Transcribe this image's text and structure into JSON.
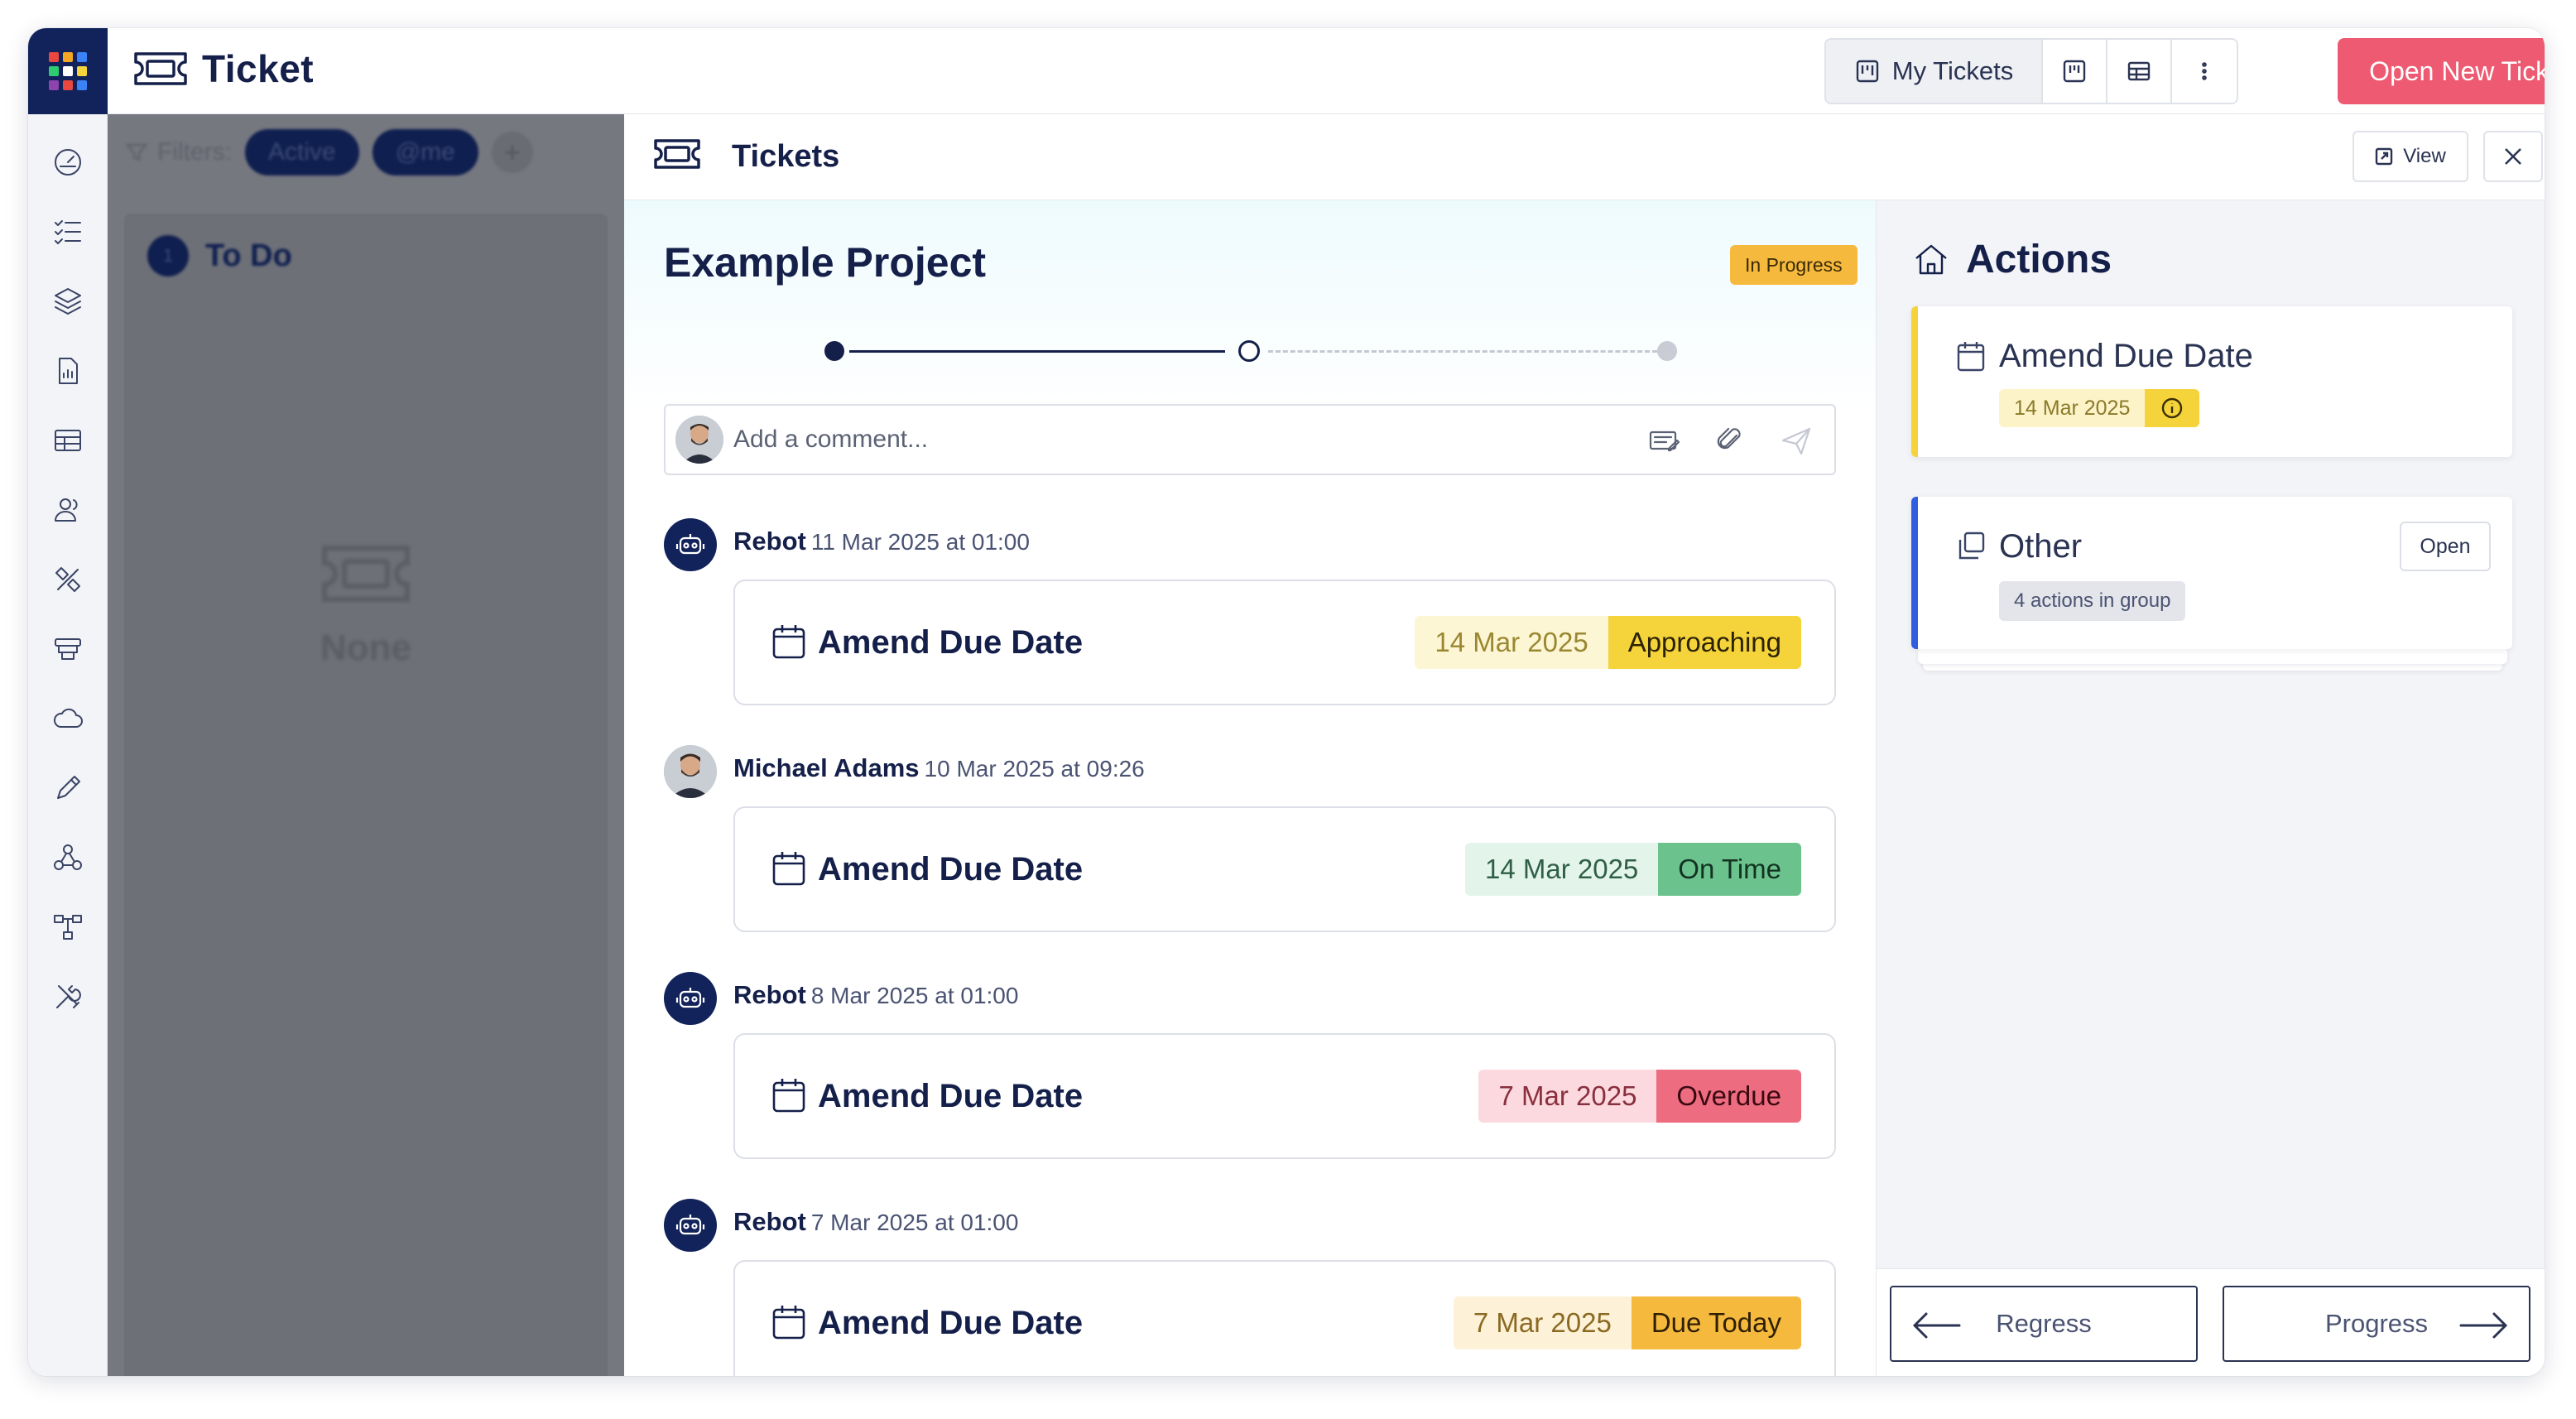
{
  "app": {
    "name": "Ticket",
    "tile_colors": [
      "#e9473f",
      "#f5a623",
      "#3b82f6",
      "#2ecc71",
      "#ffffff",
      "#f5d33a",
      "#8e44ad",
      "#e9473f",
      "#3b82f6"
    ]
  },
  "rail": {
    "items": [
      {
        "icon": "dashboard-gauge-icon"
      },
      {
        "icon": "checklist-icon"
      },
      {
        "icon": "layers-icon"
      },
      {
        "icon": "report-document-icon"
      },
      {
        "icon": "table-icon"
      },
      {
        "icon": "users-icon"
      },
      {
        "icon": "tools-ruler-icon"
      },
      {
        "icon": "stack-trays-icon"
      },
      {
        "icon": "cloud-icon"
      },
      {
        "icon": "pen-icon"
      },
      {
        "icon": "webhook-icon"
      },
      {
        "icon": "hierarchy-icon"
      },
      {
        "icon": "wrench-screwdriver-icon"
      }
    ]
  },
  "header": {
    "view_my_tickets": "My Tickets",
    "new_ticket_label": "Open New Ticket",
    "accent_color": "#ee5a71"
  },
  "board": {
    "filters_label": "Filters:",
    "chip_active": "Active",
    "chip_me": "@me",
    "add_label": "+",
    "column_count": "1",
    "column_title": "To Do",
    "empty_label": "None"
  },
  "panel": {
    "title": "Tickets",
    "view_label": "View"
  },
  "ticket": {
    "project_title": "Example Project",
    "status": "In Progress",
    "status_color": "#f5b93e",
    "stepper_current": 2,
    "stepper_total": 3
  },
  "comment": {
    "placeholder": "Add a comment..."
  },
  "feed": [
    {
      "author": "Rebot",
      "avatar": "bot",
      "date": "11 Mar 2025 at 01:00",
      "title": "Amend Due Date",
      "due": "14 Mar 2025",
      "status": "Approaching",
      "date_bg": "#fdf6d4",
      "date_fg": "#9a8730",
      "status_bg": "#f5d33a",
      "status_fg": "#2b2205"
    },
    {
      "author": "Michael Adams",
      "avatar": "person",
      "date": "10 Mar 2025 at 09:26",
      "title": "Amend Due Date",
      "due": "14 Mar 2025",
      "status": "On Time",
      "date_bg": "#e3f4ea",
      "date_fg": "#2f5f45",
      "status_bg": "#6cc28d",
      "status_fg": "#123322"
    },
    {
      "author": "Rebot",
      "avatar": "bot",
      "date": "8 Mar 2025 at 01:00",
      "title": "Amend Due Date",
      "due": "7 Mar 2025",
      "status": "Overdue",
      "date_bg": "#fbd9de",
      "date_fg": "#8a2f3d",
      "status_bg": "#ee6c80",
      "status_fg": "#3a0a12"
    },
    {
      "author": "Rebot",
      "avatar": "bot",
      "date": "7 Mar 2025 at 01:00",
      "title": "Amend Due Date",
      "due": "7 Mar 2025",
      "status": "Due Today",
      "date_bg": "#fdf1d8",
      "date_fg": "#8a6a22",
      "status_bg": "#f5b93e",
      "status_fg": "#2f1f02"
    }
  ],
  "actions": {
    "title": "Actions",
    "amend": {
      "title": "Amend Due Date",
      "date": "14 Mar 2025",
      "accent": "#f5d33a"
    },
    "other": {
      "title": "Other",
      "group_label": "4 actions in group",
      "open_label": "Open",
      "accent": "#2f5ee0"
    },
    "regress_label": "Regress",
    "progress_label": "Progress"
  }
}
